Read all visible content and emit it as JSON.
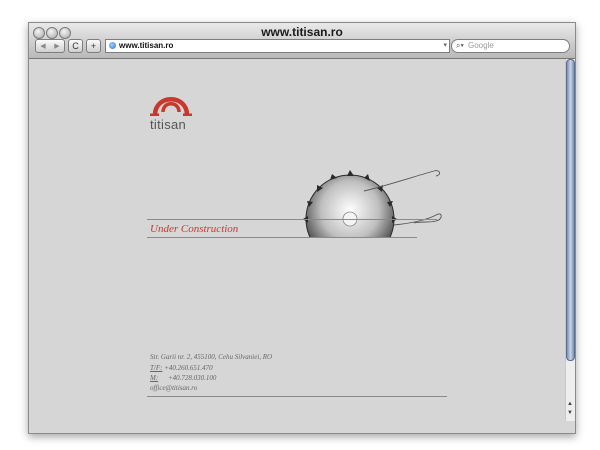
{
  "window": {
    "title": "www.titisan.ro"
  },
  "toolbar": {
    "back_label": "◀",
    "forward_label": "▶",
    "reload_label": "C",
    "add_label": "+",
    "address_value": "www.titisan.ro",
    "search_placeholder": "Google"
  },
  "page": {
    "logo_text": "titisan",
    "under_construction": "Under Construction",
    "address_line": "Str. Garii nr. 2, 455100, Cehu Silvaniei, RO",
    "phone_label": "T/F:",
    "phone_value": "+40.260.651.470",
    "mobile_label": "M:",
    "mobile_value": "+40.728.030.100",
    "email": "office@titisan.ro"
  },
  "colors": {
    "accent": "#c8392b",
    "background": "#d6d6d6"
  }
}
